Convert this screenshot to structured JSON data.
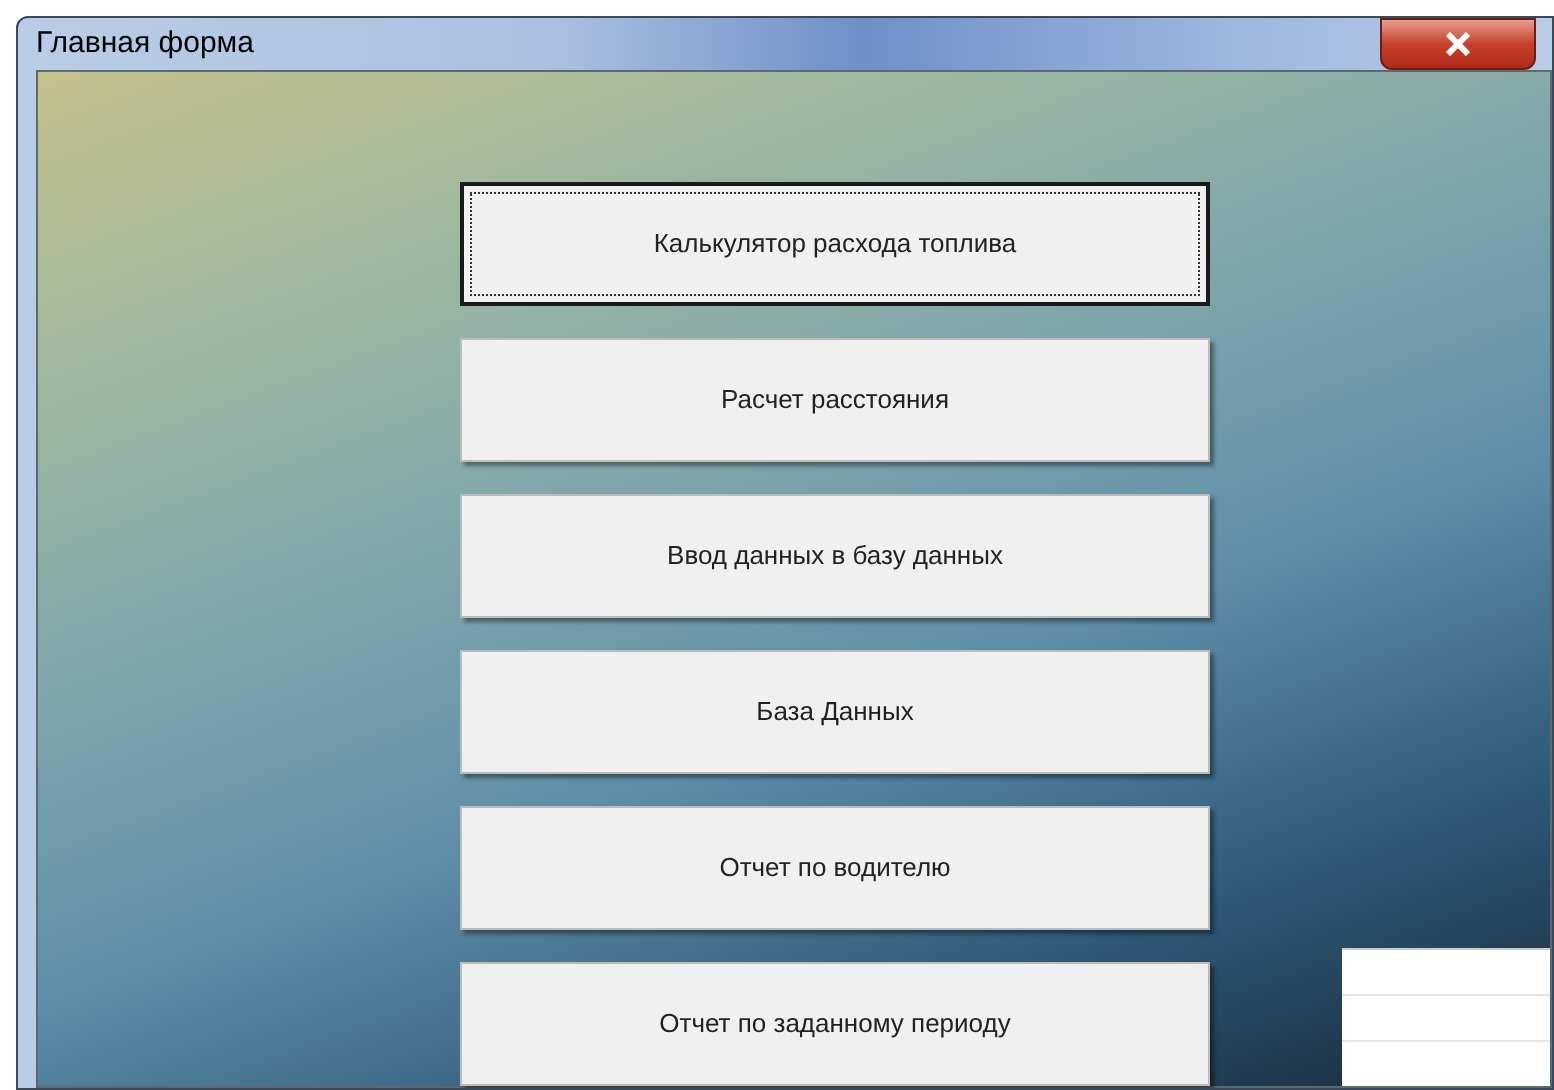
{
  "window": {
    "title": "Главная форма"
  },
  "buttons": [
    {
      "label": "Калькулятор расхода топлива",
      "focused": true
    },
    {
      "label": "Расчет расстояния",
      "focused": false
    },
    {
      "label": "Ввод данных в базу данных",
      "focused": false
    },
    {
      "label": "База Данных",
      "focused": false
    },
    {
      "label": "Отчет по водителю",
      "focused": false
    },
    {
      "label": "Отчет по заданному периоду",
      "focused": false
    }
  ]
}
